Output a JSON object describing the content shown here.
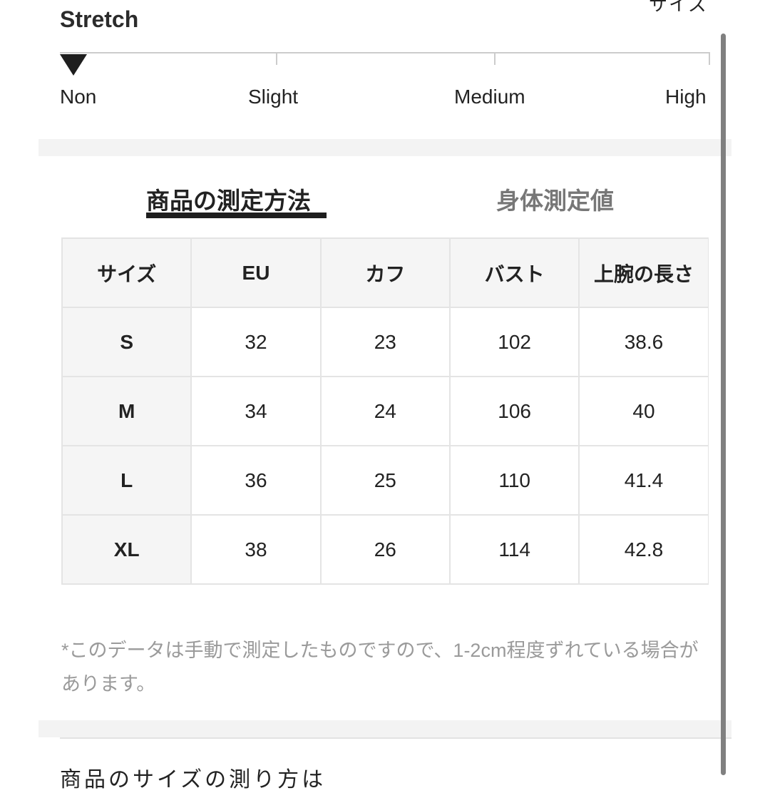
{
  "header": {
    "clipped_top_text": "サイズ"
  },
  "stretch": {
    "title": "Stretch",
    "levels": [
      "Non",
      "Slight",
      "Medium",
      "High"
    ],
    "selected_level": "Non",
    "selected_index": 0
  },
  "tabs": [
    {
      "label": "商品の測定方法",
      "active": true
    },
    {
      "label": "身体測定値",
      "active": false
    }
  ],
  "size_table": {
    "headers": [
      "サイズ",
      "EU",
      "カフ",
      "バスト",
      "上腕の長さ"
    ],
    "rows": [
      {
        "size": "S",
        "eu": "32",
        "cuff": "23",
        "bust": "102",
        "upper_arm_length": "38.6"
      },
      {
        "size": "M",
        "eu": "34",
        "cuff": "24",
        "bust": "106",
        "upper_arm_length": "40"
      },
      {
        "size": "L",
        "eu": "36",
        "cuff": "25",
        "bust": "110",
        "upper_arm_length": "41.4"
      },
      {
        "size": "XL",
        "eu": "38",
        "cuff": "26",
        "bust": "114",
        "upper_arm_length": "42.8"
      }
    ]
  },
  "note": "*このデータは手動で測定したものですので、1-2cm程度ずれている場合があります。",
  "footer": {
    "clipped_bottom_text": "商品のサイズの測り方は"
  },
  "colors": {
    "text_primary": "#222222",
    "text_muted": "#9a9a9a",
    "tab_inactive": "#777777",
    "header_bg": "#f5f5f5",
    "border": "#e4e4e4",
    "indicator": "#1e1e1e"
  }
}
